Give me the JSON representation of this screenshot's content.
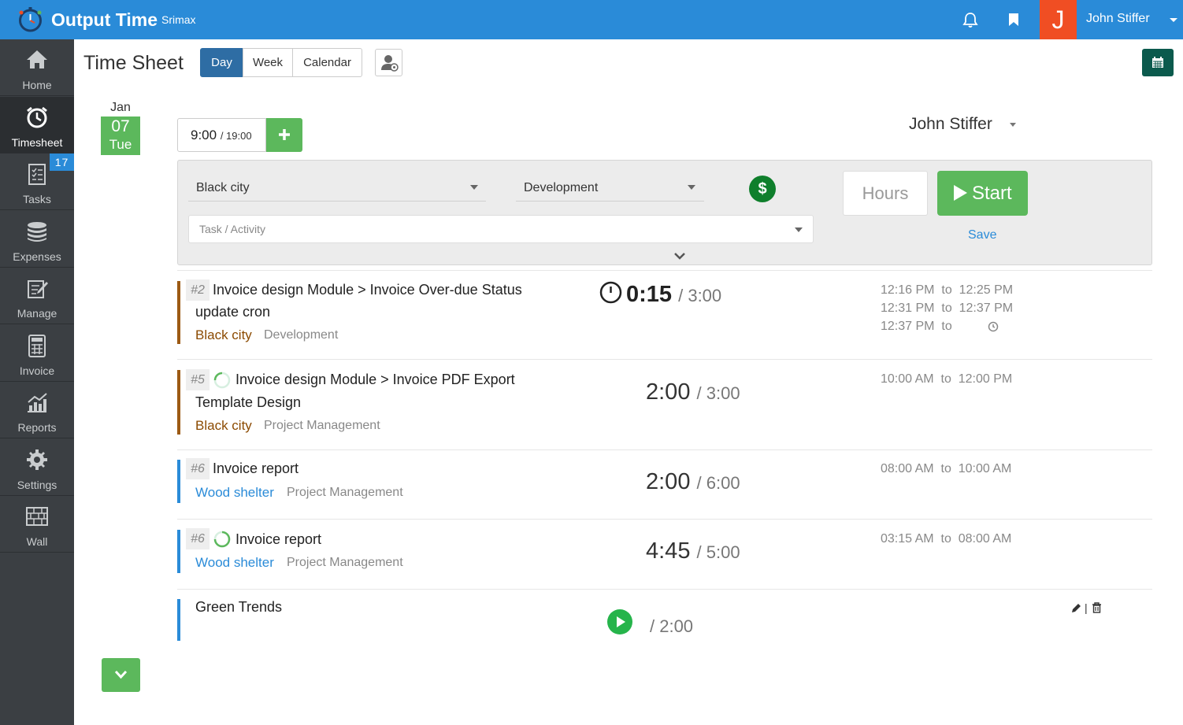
{
  "app": {
    "name": "Output Time",
    "org": "Srimax"
  },
  "topbar": {
    "avatar_letter": "J",
    "user_name": "John Stiffer"
  },
  "sidebar": {
    "items": [
      {
        "label": "Home",
        "icon": "home-icon"
      },
      {
        "label": "Timesheet",
        "icon": "alarm-clock-icon",
        "active": true
      },
      {
        "label": "Tasks",
        "icon": "checklist-icon",
        "badge": "17"
      },
      {
        "label": "Expenses",
        "icon": "coins-icon"
      },
      {
        "label": "Manage",
        "icon": "edit-note-icon"
      },
      {
        "label": "Invoice",
        "icon": "calculator-icon"
      },
      {
        "label": "Reports",
        "icon": "chart-icon"
      },
      {
        "label": "Settings",
        "icon": "gear-icon"
      },
      {
        "label": "Wall",
        "icon": "brick-wall-icon"
      }
    ]
  },
  "header": {
    "title": "Time Sheet",
    "views": [
      "Day",
      "Week",
      "Calendar"
    ],
    "active_view": "Day"
  },
  "date": {
    "month": "Jan",
    "day": "07",
    "weekday": "Tue"
  },
  "summary": {
    "logged": "9:00",
    "total": "/ 19:00"
  },
  "selected_user": "John Stiffer",
  "entry_form": {
    "client": "Black city",
    "category": "Development",
    "billable_symbol": "$",
    "task_placeholder": "Task / Activity",
    "hours_placeholder": "Hours",
    "start_label": "Start",
    "save_label": "Save"
  },
  "colors": {
    "brand_blue": "#2a8bd8",
    "green": "#5cb85c",
    "brown_client": "#8b4a00",
    "blue_client": "#2a8bd8"
  },
  "entries": [
    {
      "number": "#2",
      "title_line1": "Invoice design Module > Invoice Over-due Status",
      "title_line2": "update cron",
      "client": "Black city",
      "activity": "Development",
      "duration": "0:15",
      "estimate": "/ 3:00",
      "running": true,
      "ranges": [
        {
          "from": "12:16 PM",
          "to": "12:25 PM"
        },
        {
          "from": "12:31 PM",
          "to": "12:37 PM"
        },
        {
          "from": "12:37 PM",
          "to": ""
        }
      ],
      "to_word": "to"
    },
    {
      "number": "#5",
      "title_line1": "Invoice design Module > Invoice PDF Export",
      "title_line2": "Template Design",
      "client": "Black city",
      "activity": "Project Management",
      "duration": "2:00",
      "estimate": "/ 3:00",
      "ranges": [
        {
          "from": "10:00 AM",
          "to": "12:00 PM"
        }
      ],
      "to_word": "to"
    },
    {
      "number": "#6",
      "title_line1": "Invoice report",
      "client": "Wood shelter",
      "activity": "Project Management",
      "duration": "2:00",
      "estimate": "/ 6:00",
      "ranges": [
        {
          "from": "08:00 AM",
          "to": "10:00 AM"
        }
      ],
      "to_word": "to"
    },
    {
      "number": "#6",
      "title_line1": "Invoice report",
      "client": "Wood shelter",
      "activity": "Project Management",
      "duration": "4:45",
      "estimate": "/ 5:00",
      "ranges": [
        {
          "from": "03:15 AM",
          "to": "08:00 AM"
        }
      ],
      "to_word": "to"
    },
    {
      "title_line1": "Green Trends",
      "estimate": "/ 2:00",
      "actions_sep": "|"
    }
  ]
}
